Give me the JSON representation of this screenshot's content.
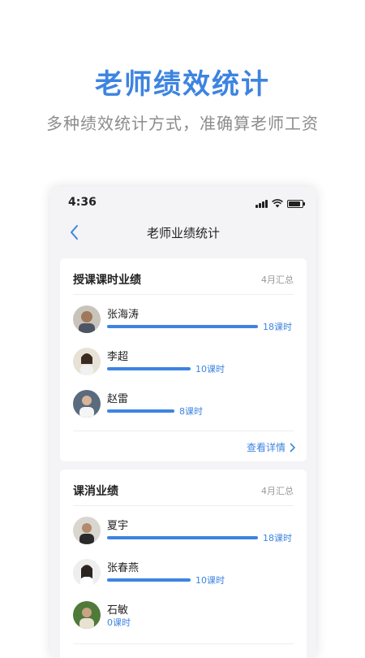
{
  "hero": {
    "title": "老师绩效统计",
    "subtitle": "多种绩效统计方式，准确算老师工资"
  },
  "status_bar": {
    "time": "4:36",
    "icons": [
      "signal-icon",
      "wifi-icon",
      "battery-icon"
    ]
  },
  "nav": {
    "title": "老师业绩统计",
    "back_icon": "chevron-left-icon"
  },
  "colors": {
    "accent": "#3d84e0",
    "muted": "#999999",
    "background": "#f4f4f6"
  },
  "cards": [
    {
      "title": "授课课时业绩",
      "period": "4月汇总",
      "max_hours": 18,
      "items": [
        {
          "name": "张海涛",
          "hours": 18,
          "hours_label": "18课时"
        },
        {
          "name": "李超",
          "hours": 10,
          "hours_label": "10课时"
        },
        {
          "name": "赵雷",
          "hours": 8,
          "hours_label": "8课时"
        }
      ],
      "detail_label": "查看详情"
    },
    {
      "title": "课消业绩",
      "period": "4月汇总",
      "max_hours": 18,
      "items": [
        {
          "name": "夏宇",
          "hours": 18,
          "hours_label": "18课时"
        },
        {
          "name": "张春燕",
          "hours": 10,
          "hours_label": "10课时"
        },
        {
          "name": "石敏",
          "hours": 0,
          "hours_label": "0课时"
        }
      ]
    }
  ]
}
